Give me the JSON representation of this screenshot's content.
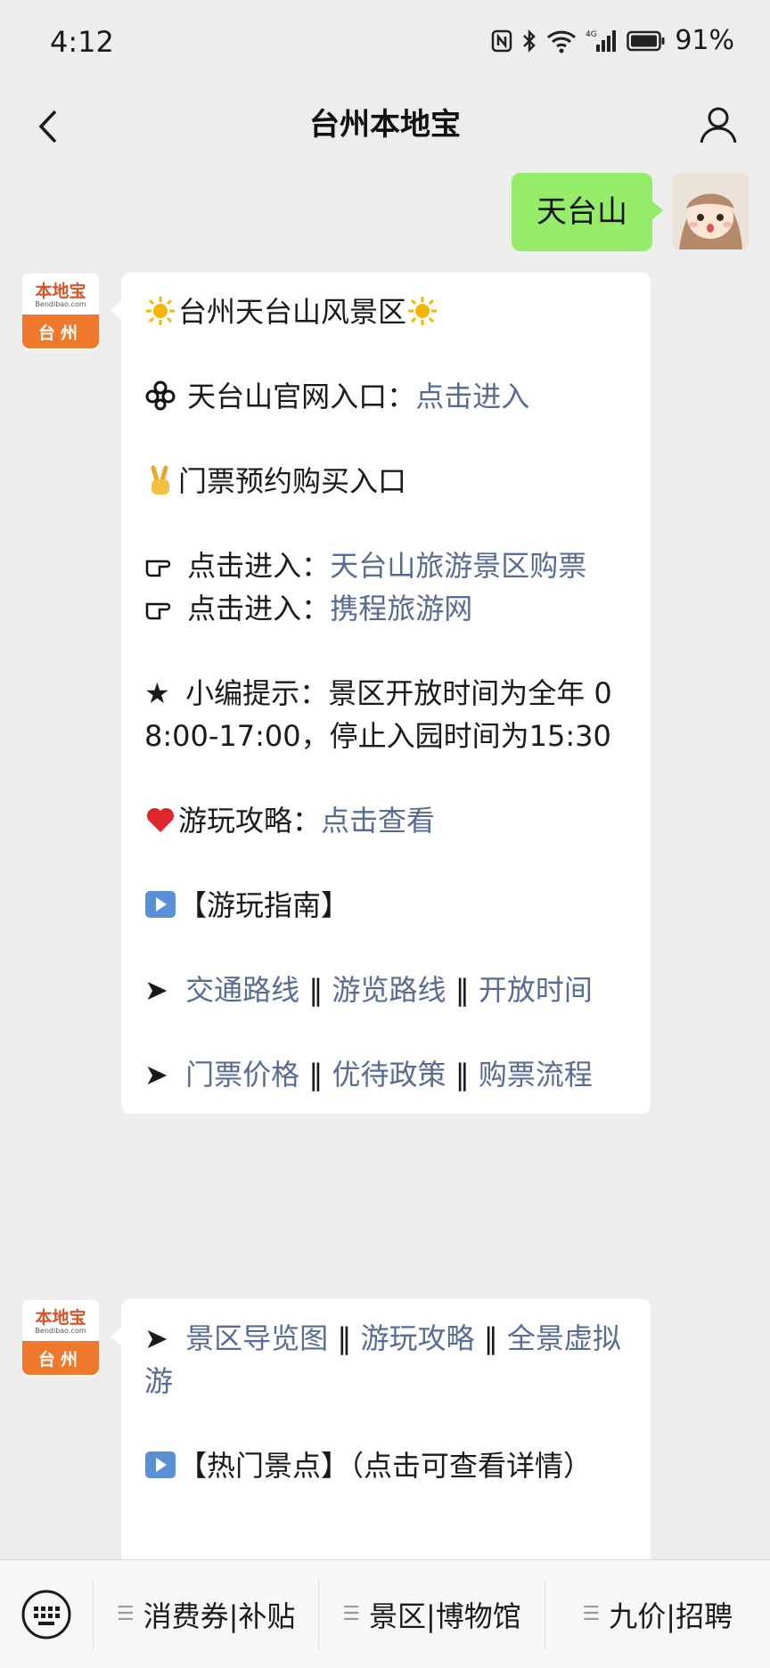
{
  "status": {
    "time": "4:12",
    "battery": "91%"
  },
  "nav": {
    "title": "台州本地宝"
  },
  "user_message": "天台山",
  "bot_avatar": {
    "logo_text": "本地宝",
    "logo_sub": "Bendibao.com",
    "city": "台州"
  },
  "message1": {
    "title": "台州天台山风景区",
    "official_label": "天台山官网入口：",
    "official_link": "点击进入",
    "ticket_heading": "门票预约购买入口",
    "enter_label_1": "点击进入：",
    "enter_link_1": "天台山旅游景区购票",
    "enter_label_2": "点击进入：",
    "enter_link_2": "携程旅游网",
    "tip_label": "小编提示：",
    "tip_text": "景区开放时间为全年 08:00-17:00，停止入园时间为15:30",
    "guide_label": "游玩攻略：",
    "guide_link": "点击查看",
    "section_guide": "【游玩指南】",
    "row1": [
      "交通路线",
      "游览路线",
      "开放时间"
    ],
    "row2": [
      "门票价格",
      "优待政策",
      "购票流程"
    ]
  },
  "message2": {
    "row3": [
      "景区导览图",
      "游玩攻略",
      "全景虚拟游"
    ],
    "section_hot": "【热门景点】",
    "section_hot_note": "（点击可查看详情）"
  },
  "separator": "‖",
  "bottom_menu": [
    "消费券|补贴",
    "景区|博物馆",
    "九价|招聘"
  ],
  "icons": [
    "back-arrow-icon",
    "profile-icon",
    "sun-icon",
    "flower-icon",
    "victory-hand-icon",
    "pointing-hand-icon",
    "star-icon",
    "heart-icon",
    "play-button-icon",
    "arrow-icon",
    "keyboard-icon",
    "menu-icon"
  ],
  "colors": {
    "link": "#576b95",
    "user_bubble": "#95ec69",
    "background": "#ededed",
    "city_badge": "#f0782d"
  }
}
